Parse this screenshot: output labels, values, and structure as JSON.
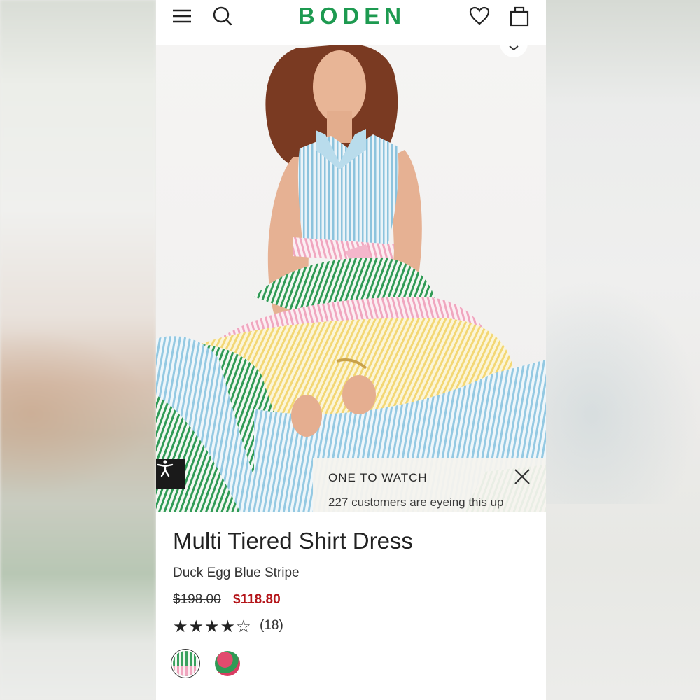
{
  "header": {
    "brand": "BODEN",
    "brand_color": "#1d9a50",
    "icons": [
      "menu-icon",
      "search-icon",
      "heart-icon",
      "bag-icon"
    ]
  },
  "gallery": {
    "image_count": 6,
    "active_index": 0
  },
  "notification": {
    "title": "ONE TO WATCH",
    "message": "227 customers are eyeing this up"
  },
  "product": {
    "name": "Multi Tiered Shirt Dress",
    "color_name": "Duck Egg Blue Stripe",
    "original_price": "$198.00",
    "sale_price": "$118.80",
    "sale_color": "#b4151a",
    "rating": 4.5,
    "rating_stars": "★★★★☆",
    "review_count": "(18)"
  },
  "swatches": [
    {
      "name": "multi-stripe",
      "selected": true
    },
    {
      "name": "green-pink",
      "selected": false
    }
  ]
}
